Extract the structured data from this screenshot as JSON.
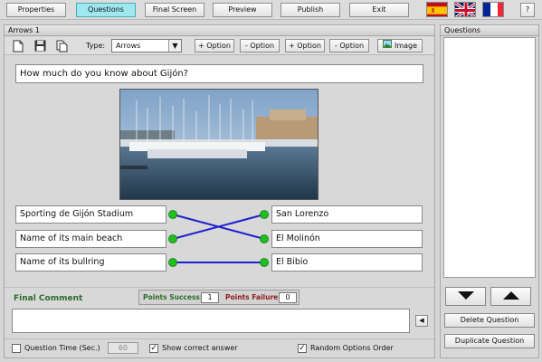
{
  "menu": {
    "properties": "Properties",
    "questions": "Questions",
    "final_screen": "Final Screen",
    "preview": "Preview",
    "publish": "Publish",
    "exit": "Exit",
    "help": "?"
  },
  "flags": [
    "spain-flag-icon",
    "uk-flag-icon",
    "france-flag-icon"
  ],
  "editor": {
    "header": "Arrows 1",
    "type_label": "Type:",
    "type_value": "Arrows",
    "add_option_1": "+ Option",
    "remove_option_1": "- Option",
    "add_option_2": "+ Option",
    "remove_option_2": "- Option",
    "image_button": "Image",
    "question_text": "How much do you know about Gijón?",
    "left_options": [
      "Sporting de Gijón Stadium",
      "Name of its main beach",
      "Name of its bullring"
    ],
    "right_options": [
      "San Lorenzo",
      "El Molinón",
      "El Bibio"
    ],
    "connections": [
      [
        0,
        1
      ],
      [
        1,
        0
      ],
      [
        2,
        2
      ]
    ],
    "final_comment_label": "Final Comment",
    "points_success_label": "Points Success:",
    "points_success_value": "1",
    "points_failure_label": "Points Failure:",
    "points_failure_value": "0",
    "comment_value": "",
    "question_time_label": "Question Time (Sec.)",
    "question_time_value": "60",
    "show_correct_label": "Show correct answer",
    "random_order_label": "Random Options Order",
    "question_time_checked": false,
    "show_correct_checked": true,
    "random_order_checked": true
  },
  "questions_panel": {
    "header": "Questions",
    "delete_button": "Delete Question",
    "duplicate_button": "Duplicate Question"
  },
  "colors": {
    "active_tab": "#9fe8ef",
    "connector_dot": "#1fbf1f",
    "arrow_line": "#1f1fd0",
    "final_comment": "#2c6b2c",
    "points_failure": "#8b1a1a"
  }
}
